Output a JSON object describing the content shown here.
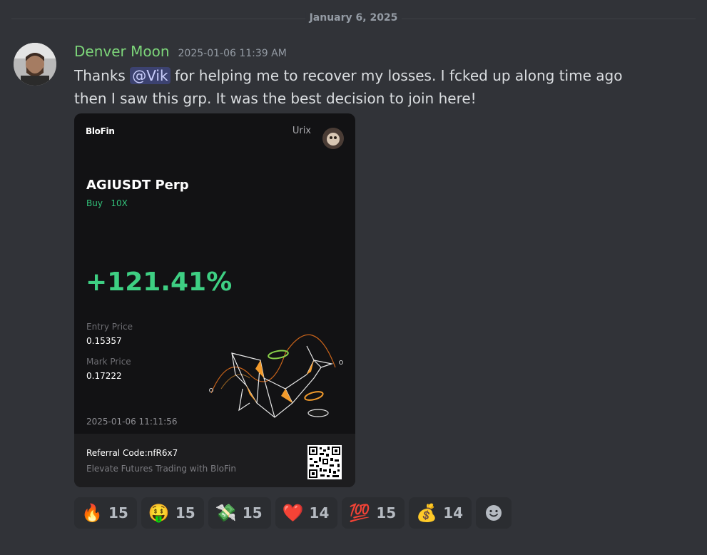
{
  "divider": {
    "date": "January 6, 2025"
  },
  "message": {
    "username": "Denver Moon",
    "timestamp": "2025-01-06 11:39 AM",
    "text_before": "Thanks ",
    "mention": "@Vik",
    "text_after": "  for helping me to recover my losses. I fcked up along time ago then I saw this grp. It was the best decision to join here!"
  },
  "card": {
    "brand": "BloFin",
    "user": "Urix",
    "pair": "AGIUSDT Perp",
    "side": "Buy",
    "leverage": "10X",
    "pnl": "+121.41%",
    "entry_label": "Entry Price",
    "entry_value": "0.15357",
    "mark_label": "Mark Price",
    "mark_value": "0.17222",
    "time": "2025-01-06 11:11:56",
    "referral": "Referral Code:nfR6x7",
    "tagline": "Elevate Futures Trading with BloFin",
    "colors": {
      "accent_green": "#3ecf83",
      "orange": "#f39b2c"
    }
  },
  "reactions": [
    {
      "emoji": "🔥",
      "count": "15"
    },
    {
      "emoji": "🤑",
      "count": "15"
    },
    {
      "emoji": "💸",
      "count": "15"
    },
    {
      "emoji": "❤️",
      "count": "14"
    },
    {
      "emoji": "💯",
      "count": "15"
    },
    {
      "emoji": "💰",
      "count": "14"
    }
  ],
  "add_reaction_icon": "smiley-add-reaction-icon"
}
